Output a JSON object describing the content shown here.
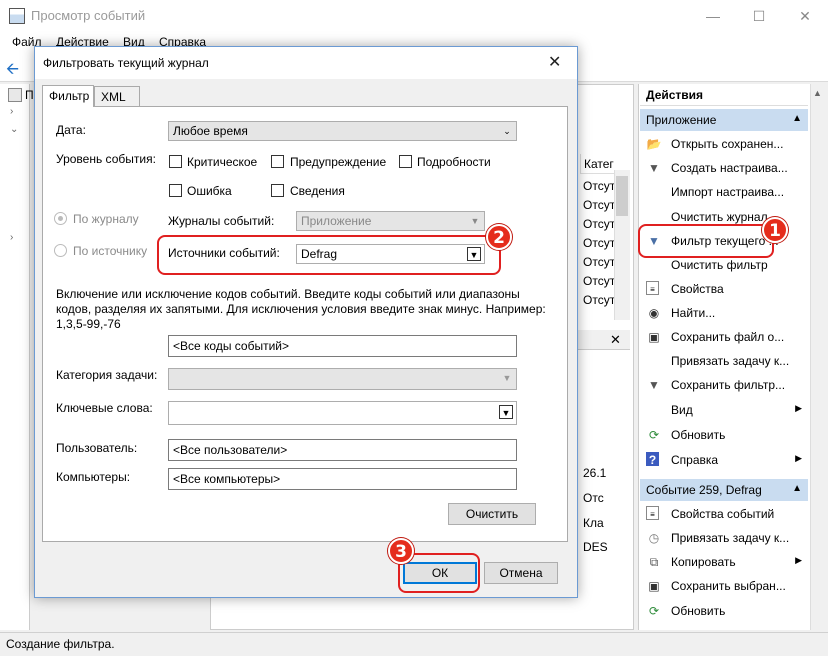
{
  "window": {
    "title": "Просмотр событий",
    "menu": [
      "Файл",
      "Действие",
      "Вид",
      "Справка"
    ],
    "left_tree_label": "П"
  },
  "center": {
    "col_header": "Катег",
    "rows": [
      "Отсут",
      "Отсут",
      "Отсут",
      "Отсут",
      "Отсут",
      "Отсут",
      "Отсут"
    ],
    "lower_cells": [
      "26.1",
      "Отс",
      "Кла",
      "DES"
    ]
  },
  "actions": {
    "title": "Действия",
    "section1": "Приложение",
    "section1_items": [
      {
        "label": "Открыть сохранен...",
        "icon": "folder-open-icon"
      },
      {
        "label": "Создать настраива...",
        "icon": "filter-icon"
      },
      {
        "label": "Импорт настраива...",
        "icon": "none"
      },
      {
        "label": "Очистить журнал",
        "icon": "none"
      },
      {
        "label": "Фильтр текущего ...",
        "icon": "filter-icon"
      },
      {
        "label": "Очистить фильтр",
        "icon": "none"
      },
      {
        "label": "Свойства",
        "icon": "properties-icon"
      },
      {
        "label": "Найти...",
        "icon": "binoculars-icon"
      },
      {
        "label": "Сохранить файл о...",
        "icon": "save-icon"
      },
      {
        "label": "Привязать задачу к...",
        "icon": "none"
      },
      {
        "label": "Сохранить фильтр...",
        "icon": "filter-icon"
      },
      {
        "label": "Вид",
        "icon": "none"
      },
      {
        "label": "Обновить",
        "icon": "refresh-icon"
      },
      {
        "label": "Справка",
        "icon": "help-icon"
      }
    ],
    "section2": "Событие 259, Defrag",
    "section2_items": [
      {
        "label": "Свойства событий",
        "icon": "properties-icon"
      },
      {
        "label": "Привязать задачу к...",
        "icon": "task-icon"
      },
      {
        "label": "Копировать",
        "icon": "copy-icon"
      },
      {
        "label": "Сохранить выбран...",
        "icon": "save-icon"
      },
      {
        "label": "Обновить",
        "icon": "refresh-icon"
      }
    ]
  },
  "status": "Создание фильтра.",
  "dialog": {
    "title": "Фильтровать текущий журнал",
    "tabs": [
      "Фильтр",
      "XML"
    ],
    "date_label": "Дата:",
    "date_value": "Любое время",
    "level_label": "Уровень события:",
    "levels": [
      "Критическое",
      "Предупреждение",
      "Подробности",
      "Ошибка",
      "Сведения"
    ],
    "by_log_label": "По журналу",
    "by_source_label": "По источнику",
    "logs_label": "Журналы событий:",
    "logs_value": "Приложение",
    "sources_label": "Источники событий:",
    "sources_value": "Defrag",
    "codes_help": "Включение или исключение кодов событий. Введите коды событий или диапазоны кодов, разделяя их запятыми. Для исключения условия введите знак минус. Например: 1,3,5-99,-76",
    "codes_value": "<Все коды событий>",
    "task_label": "Категория задачи:",
    "keywords_label": "Ключевые слова:",
    "user_label": "Пользователь:",
    "user_value": "<Все пользователи>",
    "computers_label": "Компьютеры:",
    "computers_value": "<Все компьютеры>",
    "clear_btn": "Очистить",
    "ok_btn": "ОК",
    "cancel_btn": "Отмена"
  },
  "badges": [
    "1",
    "2",
    "3"
  ]
}
